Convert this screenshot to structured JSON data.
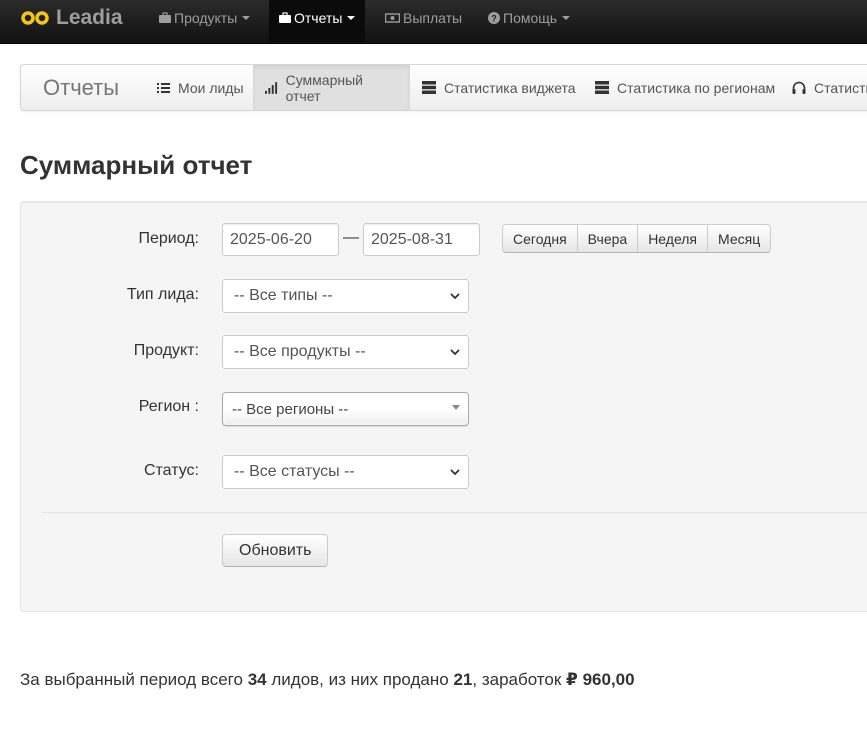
{
  "colors": {
    "navbar_bg": "#1b1b1b",
    "logo_yellow": "#f6c614",
    "nav_text": "#9d9d9d",
    "active_text": "#ffffff"
  },
  "navbar": {
    "brand": "Leadia",
    "items": [
      {
        "label": "Продукты",
        "icon": "briefcase-icon",
        "dropdown": true
      },
      {
        "label": "Отчеты",
        "icon": "briefcase-icon",
        "dropdown": true,
        "active": true
      },
      {
        "label": "Выплаты",
        "icon": "money-icon",
        "dropdown": false
      },
      {
        "label": "Помощь",
        "icon": "question-circle-icon",
        "dropdown": true
      }
    ]
  },
  "subnav": {
    "title": "Отчеты",
    "items": [
      {
        "label": "Мои лиды",
        "icon": "list-icon"
      },
      {
        "label": "Суммарный отчет",
        "icon": "signal-bars-icon",
        "active": true
      },
      {
        "label": "Статистика виджета",
        "icon": "server-icon"
      },
      {
        "label": "Статистика по регионам",
        "icon": "server-icon"
      },
      {
        "label": "Статисти",
        "icon": "headphones-icon"
      }
    ]
  },
  "page": {
    "title": "Суммарный отчет"
  },
  "form": {
    "period_label": "Период:",
    "date_from": "2025-06-20",
    "date_separator": "—",
    "date_to": "2025-08-31",
    "quick_ranges": [
      "Сегодня",
      "Вчера",
      "Неделя",
      "Месяц"
    ],
    "lead_type_label": "Тип лида:",
    "lead_type_value": "-- Все типы --",
    "product_label": "Продукт:",
    "product_value": "-- Все продукты --",
    "region_label": "Регион :",
    "region_value": "-- Все регионы --",
    "status_label": "Статус:",
    "status_value": "-- Все статусы --",
    "submit_label": "Обновить"
  },
  "summary": {
    "prefix": "За выбранный период всего",
    "total_leads": "34",
    "middle": "лидов, из них продано",
    "sold": "21",
    "earnings_prefix": ", заработок",
    "earnings": "₽ 960,00"
  }
}
